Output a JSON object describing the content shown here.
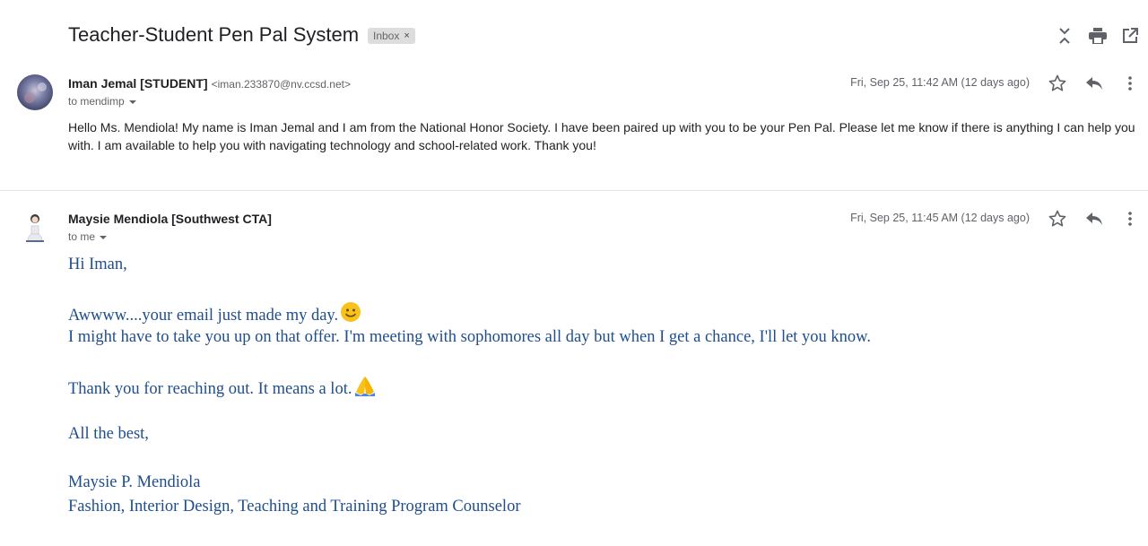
{
  "thread": {
    "subject": "Teacher-Student Pen Pal System",
    "label": "Inbox",
    "label_remove": "×"
  },
  "icons": {
    "collapse": "collapse-icon",
    "print": "print-icon",
    "open_new_window": "open-in-new-window-icon",
    "star": "star-icon",
    "reply": "reply-icon",
    "more": "more-vert-icon",
    "caret": "caret-down-icon",
    "smile": "smiling-face-emoji",
    "folded_hands": "folded-hands-emoji"
  },
  "messages": [
    {
      "sender_name": "Iman Jemal [STUDENT]",
      "sender_email": "<iman.233870@nv.ccsd.net>",
      "to": "to mendimp",
      "date": "Fri, Sep 25, 11:42 AM (12 days ago)",
      "body": "Hello Ms. Mendiola! My name is Iman Jemal and I am from the National Honor Society. I have been paired up with you to be your Pen Pal. Please let me know if there is anything I can help you with. I am available to help you with navigating technology and school-related work. Thank you!"
    },
    {
      "sender_name": "Maysie Mendiola [Southwest CTA]",
      "to": "to me",
      "date": "Fri, Sep 25, 11:45 AM (12 days ago)",
      "body_lines": [
        "Hi Iman,",
        "",
        "Awwww....your email just made my day.",
        "I might have to take you up on that offer. I'm meeting with sophomores all day but when I get a chance, I'll let you know.",
        "",
        "Thank you for reaching out. It means a lot.",
        "",
        "All the best,",
        "",
        "Maysie P. Mendiola",
        "Fashion, Interior Design, Teaching and Training Program Counselor"
      ]
    }
  ],
  "colors": {
    "reply_text": "#1f4e8c",
    "label_bg": "#dddddd",
    "muted": "#5f6368"
  }
}
